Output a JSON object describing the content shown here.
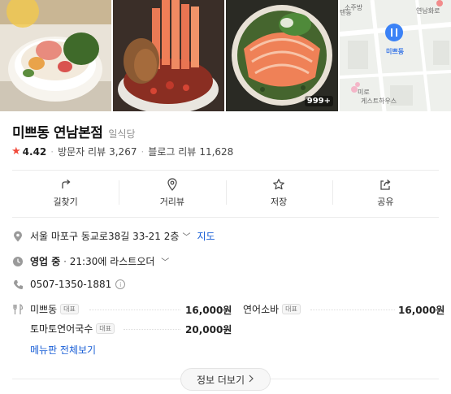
{
  "place": {
    "name": "미쁘동 연남본점",
    "category": "일식당",
    "rating": "4.42",
    "visitor_review_label": "방문자 리뷰",
    "visitor_review_count": "3,267",
    "blog_review_label": "블로그 리뷰",
    "blog_review_count": "11,628"
  },
  "photos": {
    "count_badge": "999+",
    "map": {
      "pin_label": "미쁘동",
      "labels": [
        "소주방",
        "연남화로",
        "텐동",
        "미로",
        "게스트하우스"
      ]
    }
  },
  "actions": [
    {
      "label": "길찾기",
      "icon": "directions-icon"
    },
    {
      "label": "거리뷰",
      "icon": "street-view-icon"
    },
    {
      "label": "저장",
      "icon": "star-icon"
    },
    {
      "label": "공유",
      "icon": "share-icon"
    }
  ],
  "info": {
    "address": "서울 마포구 동교로38길 33-21 2층",
    "map_link": "지도",
    "status": "영업 중",
    "hours": "21:30에 라스트오더",
    "phone": "0507-1350-1881",
    "info_mark": "i"
  },
  "menu": {
    "items": [
      {
        "name": "미쁘동",
        "badge": "대표",
        "price": "16,000원"
      },
      {
        "name": "연어소바",
        "badge": "대표",
        "price": "16,000원"
      },
      {
        "name": "토마토연어국수",
        "badge": "대표",
        "price": "20,000원"
      }
    ],
    "view_all": "메뉴판 전체보기"
  },
  "more_info": "정보 더보기",
  "colors": {
    "accent_blue": "#1a5fd6",
    "star_red": "#f14a3b",
    "map_pin": "#3b82f6"
  }
}
